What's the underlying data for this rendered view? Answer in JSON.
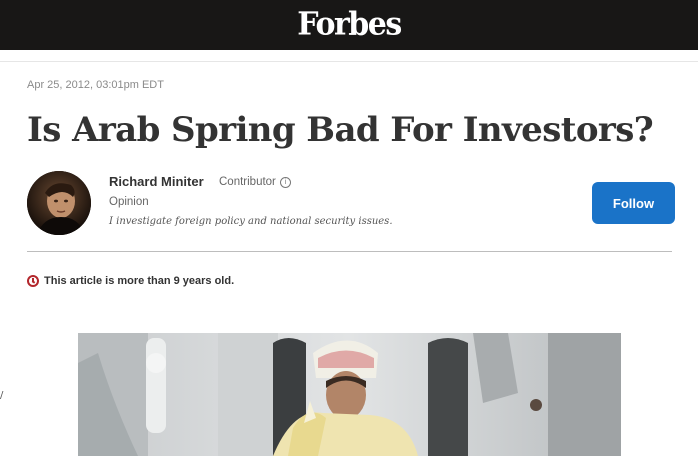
{
  "brand": {
    "logo_text": "Forbes"
  },
  "article": {
    "date": "Apr 25, 2012, 03:01pm EDT",
    "title": "Is Arab Spring Bad For Investors?",
    "age_notice": "This article is more than 9 years old."
  },
  "author": {
    "name": "Richard Miniter",
    "role": "Contributor",
    "section": "Opinion",
    "bio": "I investigate foreign policy and national security issues.",
    "follow_label": "Follow"
  },
  "colors": {
    "header_bg": "#181716",
    "follow_button": "#1a73c8",
    "age_icon": "#b3272c"
  },
  "icons": [
    "info-icon",
    "clock-icon"
  ]
}
